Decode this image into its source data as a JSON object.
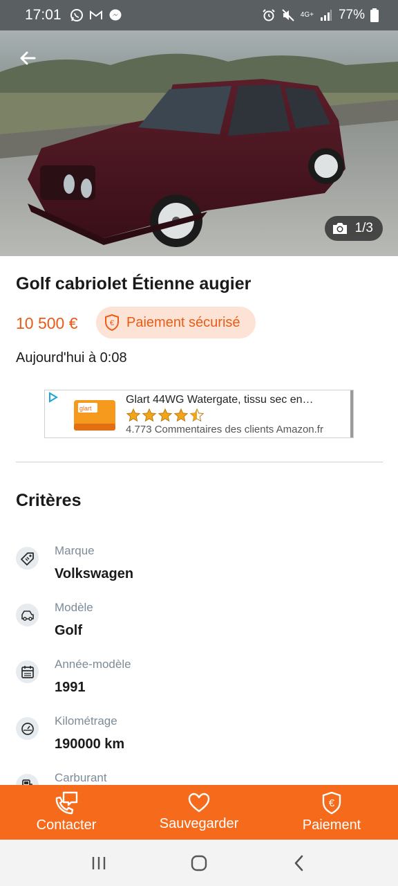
{
  "status_bar": {
    "time": "17:01",
    "network": "4G+",
    "battery": "77%",
    "icons_left": [
      "whatsapp-icon",
      "gmail-icon",
      "messenger-icon"
    ],
    "icons_right": [
      "alarm-icon",
      "mute-icon",
      "network-icon",
      "signal-icon",
      "battery-icon"
    ]
  },
  "gallery": {
    "counter": "1/3"
  },
  "listing": {
    "title": "Golf cabriolet Étienne augier",
    "price": "10 500 €",
    "secure_label": "Paiement sécurisé",
    "date": "Aujourd'hui à 0:08"
  },
  "ad": {
    "title": "Glart 44WG Watergate, tissu sec en…",
    "rating": 4.5,
    "reviews": "4.773 Commentaires des clients Amazon.fr",
    "brand": "glart"
  },
  "criteria": {
    "title": "Critères",
    "items": [
      {
        "label": "Marque",
        "value": "Volkswagen",
        "icon": "tag-icon"
      },
      {
        "label": "Modèle",
        "value": "Golf",
        "icon": "car-icon"
      },
      {
        "label": "Année-modèle",
        "value": "1991",
        "icon": "calendar-icon"
      },
      {
        "label": "Kilométrage",
        "value": "190000 km",
        "icon": "speedometer-icon"
      },
      {
        "label": "Carburant",
        "value": "",
        "icon": "fuel-icon"
      }
    ]
  },
  "actions": {
    "contact": "Contacter",
    "save": "Sauvegarder",
    "payment": "Paiement"
  },
  "colors": {
    "accent": "#f56b1b",
    "price": "#ec5a13",
    "pill_bg": "#fde3d5"
  }
}
